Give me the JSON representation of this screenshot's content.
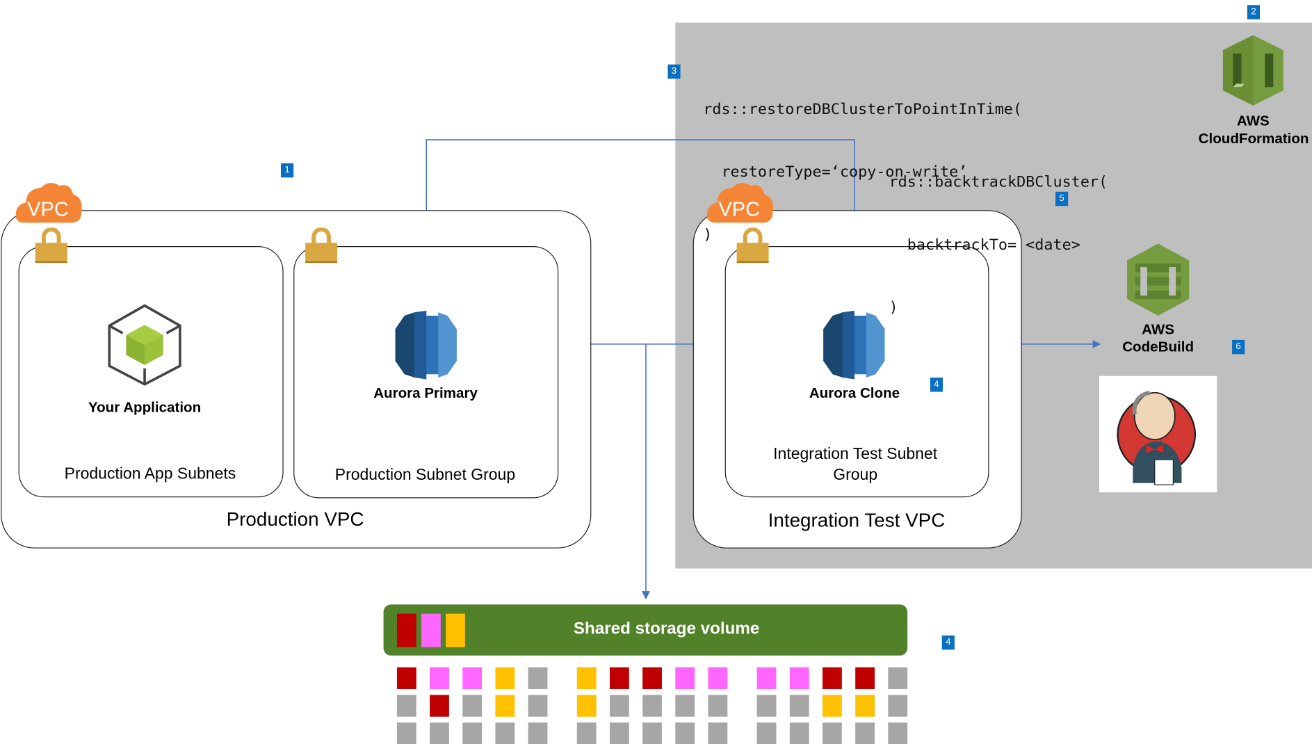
{
  "production_vpc": {
    "badge": "VPC",
    "label": "Production VPC",
    "app_subnets": {
      "label": "Production App Subnets",
      "node": "Your Application"
    },
    "subnet_group": {
      "label": "Production Subnet Group",
      "node": "Aurora Primary"
    }
  },
  "integration_vpc": {
    "badge": "VPC",
    "label": "Integration Test VPC",
    "subnet_group": {
      "label": "Integration Test Subnet Group",
      "node": "Aurora Clone"
    }
  },
  "code": {
    "restore": [
      "rds::restoreDBClusterToPointInTime(",
      "  restoreType=‘copy-on-write’",
      ")"
    ],
    "backtrack": [
      "rds::backtrackDBCluster(",
      "  backtrackTo= <date>",
      ")"
    ]
  },
  "services": {
    "cloudformation": "AWS CloudFormation",
    "codebuild": "AWS CodeBuild",
    "jenkins": "Jenkins"
  },
  "storage": {
    "title": "Shared storage volume",
    "legend_colors": [
      "#c00000",
      "#ff66ff",
      "#ffc000"
    ],
    "grid_rows": [
      [
        "red",
        "pink",
        "pink",
        "yellow",
        "gray",
        "yellow",
        "red",
        "red",
        "pink",
        "pink",
        "pink",
        "pink",
        "red",
        "red",
        "gray"
      ],
      [
        "gray",
        "red",
        "gray",
        "yellow",
        "gray",
        "yellow",
        "gray",
        "gray",
        "gray",
        "gray",
        "gray",
        "gray",
        "yellow",
        "yellow",
        "gray"
      ],
      [
        "gray",
        "gray",
        "gray",
        "gray",
        "gray",
        "gray",
        "gray",
        "gray",
        "gray",
        "gray",
        "gray",
        "gray",
        "gray",
        "gray",
        "gray"
      ]
    ]
  },
  "step_badges": [
    "1",
    "2",
    "3",
    "4",
    "4",
    "5",
    "6"
  ],
  "colors": {
    "accent_blue": "#4472c4",
    "badge_blue": "#0a6fc2",
    "vpc_orange": "#f58536",
    "lock_gold": "#d9a741",
    "aurora_blue": "#2e73b8",
    "storage_green": "#518229",
    "region_gray": "#bfbfbf",
    "block_red": "#c00000",
    "block_pink": "#ff66ff",
    "block_yellow": "#ffc000",
    "block_gray": "#a6a6a6"
  }
}
